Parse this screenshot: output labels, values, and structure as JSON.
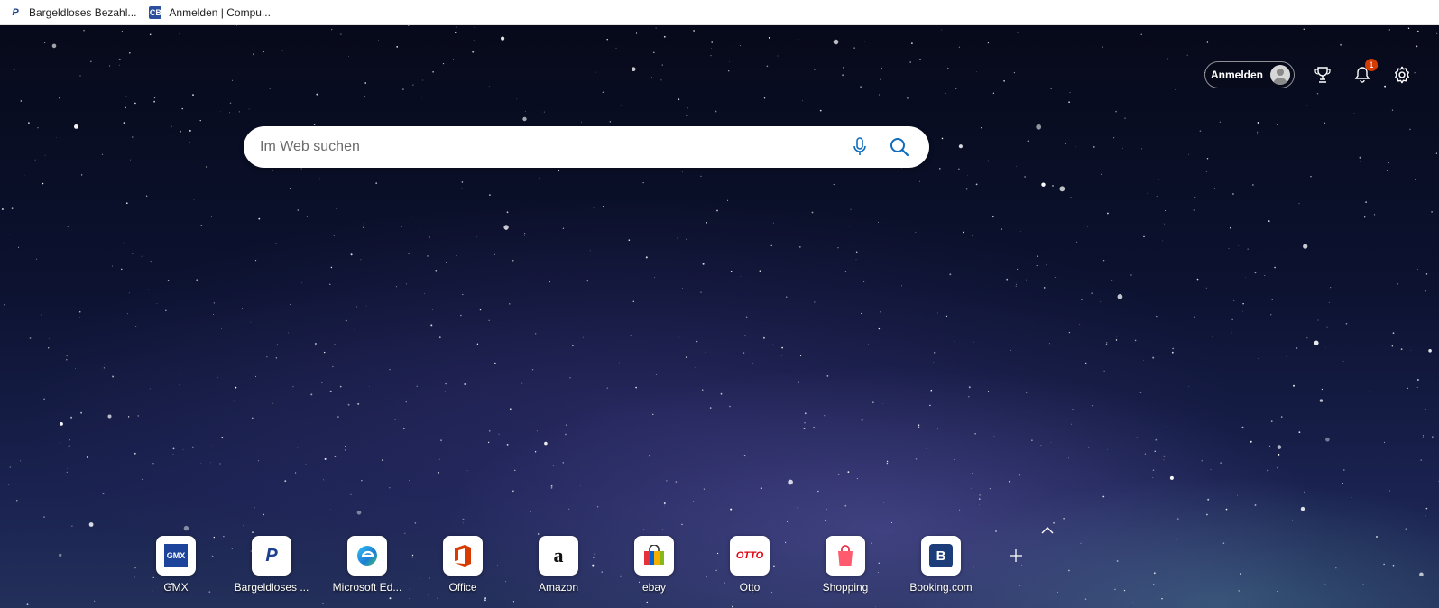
{
  "favorites_bar": {
    "items": [
      {
        "label": "Bargeldloses Bezahl...",
        "icon": "paypal-icon"
      },
      {
        "label": "Anmelden | Compu...",
        "icon": "cb-icon"
      }
    ]
  },
  "header": {
    "signin_label": "Anmelden",
    "notification_count": "1"
  },
  "search": {
    "placeholder": "Im Web suchen",
    "voice_icon": "microphone-icon",
    "search_icon": "search-icon"
  },
  "quick_links": [
    {
      "label": "GMX",
      "icon": "gmx-logo"
    },
    {
      "label": "Bargeldloses ...",
      "icon": "paypal-logo"
    },
    {
      "label": "Microsoft Ed...",
      "icon": "edge-logo"
    },
    {
      "label": "Office",
      "icon": "office-logo"
    },
    {
      "label": "Amazon",
      "icon": "amazon-logo"
    },
    {
      "label": "ebay",
      "icon": "ebay-logo"
    },
    {
      "label": "Otto",
      "icon": "otto-logo"
    },
    {
      "label": "Shopping",
      "icon": "shopping-bag-logo"
    },
    {
      "label": "Booking.com",
      "icon": "booking-logo"
    }
  ],
  "logos": {
    "gmx": "GMX",
    "paypal": "P",
    "amazon": "a",
    "otto": "OTTO",
    "booking": "B"
  },
  "colors": {
    "accent_badge": "#d83b01",
    "paypal_blue": "#1d3f8f",
    "otto_red": "#e3000f"
  }
}
